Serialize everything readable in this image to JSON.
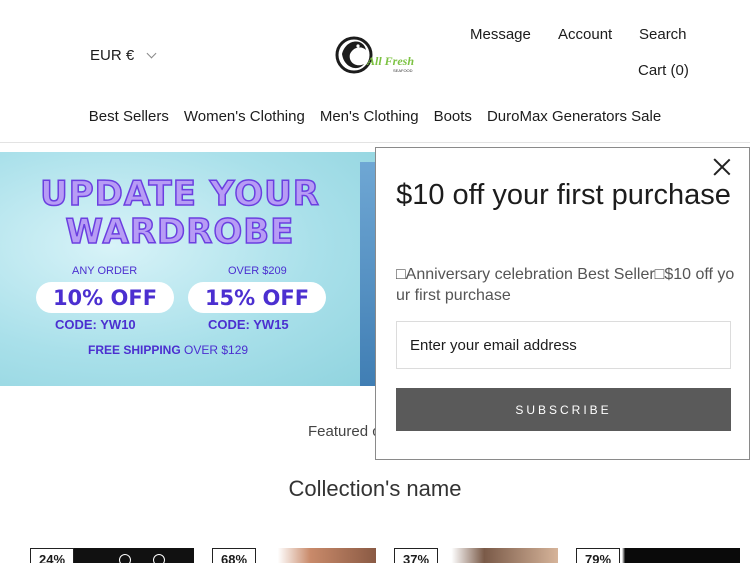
{
  "header": {
    "currency": "EUR €",
    "logo_text": "All Fresh",
    "logo_subtext": "SEAFOOD",
    "links": {
      "message": "Message",
      "account": "Account",
      "search": "Search",
      "cart": "Cart (0)"
    }
  },
  "nav": [
    "Best Sellers",
    "Women's Clothing",
    "Men's Clothing",
    "Boots",
    "DuroMax Generators Sale"
  ],
  "banner": {
    "title_line1": "UPDATE YOUR",
    "title_line2": "WARDROBE",
    "offer1": {
      "label": "ANY ORDER",
      "discount": "10% OFF",
      "code": "CODE: YW10"
    },
    "offer2": {
      "label": "OVER $209",
      "discount": "15% OFF",
      "code": "CODE: YW15"
    },
    "shipping_bold": "FREE SHIPPING",
    "shipping_rest": " OVER $129"
  },
  "featured_label": "Featured c",
  "collection_title": "Collection's name",
  "products": [
    {
      "badge": "24%"
    },
    {
      "badge": "68%"
    },
    {
      "badge": "37%"
    },
    {
      "badge": "79%"
    }
  ],
  "popup": {
    "title": "$10 off your first purchase",
    "description": "□Anniversary celebration Best Seller□$10 off your first purchase",
    "email_placeholder": "Enter your email address",
    "subscribe_label": "SUBSCRIBE"
  },
  "colors": {
    "banner_purple": "#4b2fd0",
    "button_gray": "#5a5a5a",
    "logo_green": "#7cc242"
  }
}
